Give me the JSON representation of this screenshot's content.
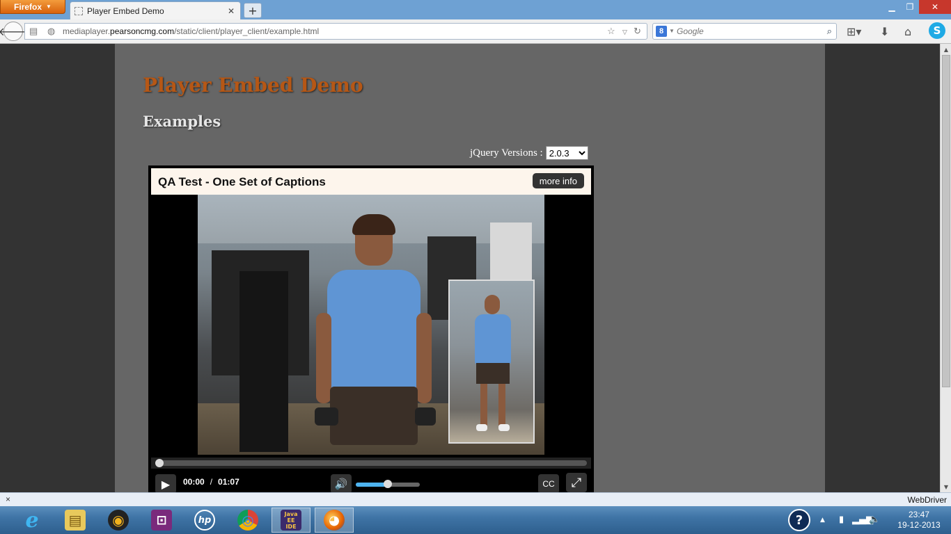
{
  "browser": {
    "menu_button": "Firefox",
    "tab_title": "Player Embed Demo",
    "new_tab": "+",
    "url_domain_pre": "mediaplayer.",
    "url_domain": "pearsoncmg.com",
    "url_path": "/static/client/player_client/example.html",
    "search_placeholder": "Google",
    "search_engine": "8",
    "accent": "#6ea1d3"
  },
  "page": {
    "heading": "Player Embed Demo",
    "subheading": "Examples",
    "jquery_label": "jQuery Versions :",
    "jquery_selected": "2.0.3",
    "heading_color": "#b65715"
  },
  "player": {
    "title": "QA Test - One Set of Captions",
    "more_info": "more info",
    "current_time": "00:00",
    "separator": "/",
    "duration": "01:07",
    "cc_label": "CC",
    "progress_fraction": 0.0,
    "volume_fraction": 0.5
  },
  "bottom_bar": {
    "close": "×",
    "label": "WebDriver"
  },
  "taskbar": {
    "items": [
      {
        "name": "internet-explorer",
        "label": "e"
      },
      {
        "name": "file-explorer",
        "label": "▤"
      },
      {
        "name": "media-player",
        "label": "◉"
      },
      {
        "name": "network-app",
        "label": "⊡"
      },
      {
        "name": "hp",
        "label": "hp"
      },
      {
        "name": "chrome",
        "label": "◎"
      },
      {
        "name": "java-ee-ide",
        "label": "Java EE IDE"
      },
      {
        "name": "firefox",
        "label": "◕"
      }
    ],
    "help": "?",
    "time": "23:47",
    "date": "19-12-2013"
  }
}
